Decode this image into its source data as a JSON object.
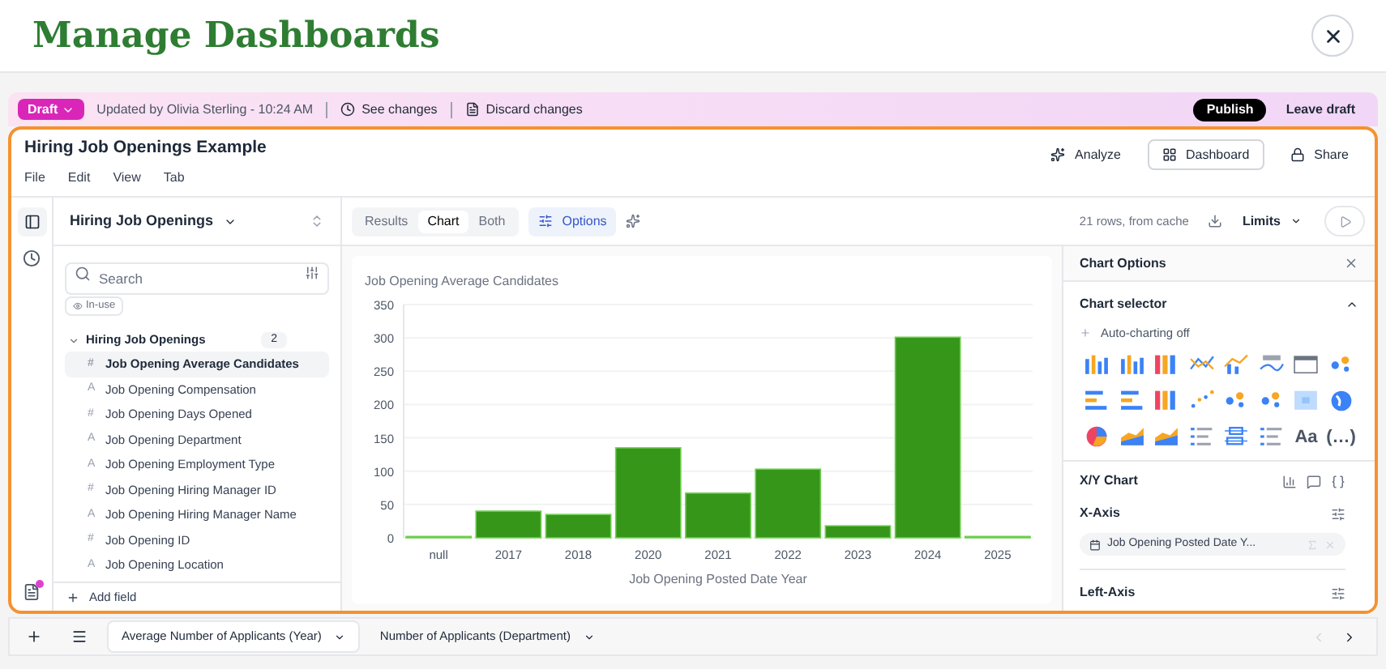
{
  "page_title": "Manage Dashboards",
  "draft_bar": {
    "badge": "Draft",
    "updated": "Updated by Olivia Sterling - 10:24 AM",
    "see_changes": "See changes",
    "discard": "Discard changes",
    "publish": "Publish",
    "leave": "Leave draft"
  },
  "workbook": {
    "title": "Hiring Job Openings Example",
    "menu": [
      "File",
      "Edit",
      "View",
      "Tab"
    ],
    "actions": [
      {
        "label": "Analyze",
        "kind": "sparkle",
        "selected": false
      },
      {
        "label": "Dashboard",
        "kind": "grid",
        "selected": true
      },
      {
        "label": "Share",
        "kind": "lock",
        "selected": false
      }
    ]
  },
  "sidebar": {
    "source": "Hiring Job Openings",
    "search": {
      "placeholder": "Search"
    },
    "filter_chip": "In-use",
    "group": {
      "name": "Hiring Job Openings",
      "count": "2",
      "expanded": true
    },
    "fields": [
      {
        "glyph": "#",
        "name": "Job Opening Average Candidates",
        "selected": true
      },
      {
        "glyph": "A",
        "name": "Job Opening Compensation",
        "selected": false
      },
      {
        "glyph": "#",
        "name": "Job Opening Days Opened",
        "selected": false
      },
      {
        "glyph": "A",
        "name": "Job Opening Department",
        "selected": false
      },
      {
        "glyph": "A",
        "name": "Job Opening Employment Type",
        "selected": false
      },
      {
        "glyph": "#",
        "name": "Job Opening Hiring Manager ID",
        "selected": false
      },
      {
        "glyph": "A",
        "name": "Job Opening Hiring Manager Name",
        "selected": false
      },
      {
        "glyph": "#",
        "name": "Job Opening ID",
        "selected": false
      },
      {
        "glyph": "A",
        "name": "Job Opening Location",
        "selected": false
      }
    ],
    "add_field": "Add field"
  },
  "toolbar": {
    "views": [
      {
        "label": "Results",
        "selected": false
      },
      {
        "label": "Chart",
        "selected": true
      },
      {
        "label": "Both",
        "selected": false
      }
    ],
    "options": "Options",
    "status": "21 rows, from cache",
    "limits": "Limits"
  },
  "chart": {
    "chart_data": {
      "type": "bar",
      "title": "Job Opening Average Candidates",
      "xlabel": "Job Opening Posted Date Year",
      "categories": [
        "null",
        "2017",
        "2018",
        "2020",
        "2021",
        "2022",
        "2023",
        "2024",
        "2025"
      ],
      "grid": true,
      "series": [
        {
          "color": "#36961a",
          "values": [
            2,
            40,
            35,
            135,
            67,
            103,
            18,
            301,
            2
          ]
        }
      ],
      "ylim": [
        0,
        350
      ],
      "yticks": [
        0,
        50,
        100,
        150,
        200,
        250,
        300,
        350
      ]
    }
  },
  "chart_options": {
    "title": "Chart Options",
    "selector": {
      "title": "Chart selector",
      "expanded": true,
      "auto": "Auto-charting off",
      "types": [
        {
          "kind": "bar"
        },
        {
          "kind": "bar"
        },
        {
          "kind": "stack"
        },
        {
          "kind": "line"
        },
        {
          "kind": "combo"
        },
        {
          "kind": "kpi"
        },
        {
          "kind": "table"
        },
        {
          "kind": "dots"
        },
        {
          "kind": "hbar"
        },
        {
          "kind": "hbar"
        },
        {
          "kind": "stack"
        },
        {
          "kind": "scatter"
        },
        {
          "kind": "dots"
        },
        {
          "kind": "dots"
        },
        {
          "kind": "heat"
        },
        {
          "kind": "globe"
        },
        {
          "kind": "pie"
        },
        {
          "kind": "area"
        },
        {
          "kind": "area"
        },
        {
          "kind": "list"
        },
        {
          "kind": "box"
        },
        {
          "kind": "list"
        },
        {
          "kind": "text",
          "label": "Aa"
        },
        {
          "kind": "text",
          "label": "(…)"
        }
      ]
    },
    "xy_title": "X/Y Chart",
    "x_axis": {
      "title": "X-Axis",
      "field": "Job Opening Posted Date Y..."
    },
    "left_axis": "Left-Axis"
  },
  "bottom_tabs": [
    {
      "label": "Average Number of Applicants (Year)",
      "selected": true
    },
    {
      "label": "Number of Applicants (Department)",
      "selected": false
    }
  ]
}
